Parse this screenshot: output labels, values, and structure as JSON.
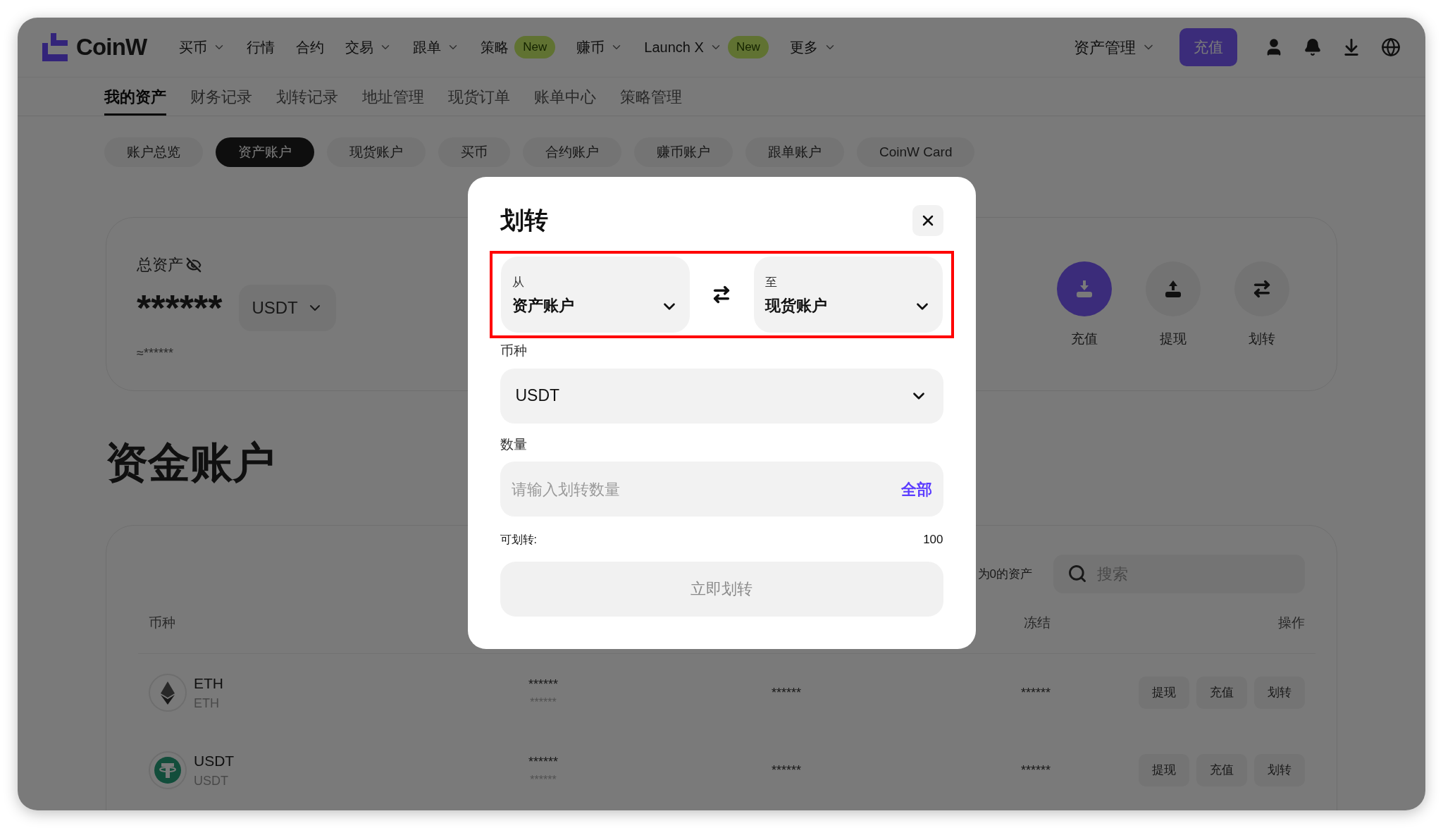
{
  "nav": {
    "logo": "CoinW",
    "items": [
      {
        "label": "买币",
        "dropdown": true
      },
      {
        "label": "行情",
        "dropdown": false
      },
      {
        "label": "合约",
        "dropdown": false
      },
      {
        "label": "交易",
        "dropdown": true
      },
      {
        "label": "跟单",
        "dropdown": true
      },
      {
        "label": "策略",
        "dropdown": false,
        "badge": "New"
      },
      {
        "label": "赚币",
        "dropdown": true
      },
      {
        "label": "Launch X",
        "dropdown": true,
        "badge": "New"
      },
      {
        "label": "更多",
        "dropdown": true
      }
    ],
    "asset_menu": "资产管理",
    "deposit_button": "充值"
  },
  "sub_tabs": [
    {
      "label": "我的资产",
      "selected": true
    },
    {
      "label": "财务记录",
      "selected": false
    },
    {
      "label": "划转记录",
      "selected": false
    },
    {
      "label": "地址管理",
      "selected": false
    },
    {
      "label": "现货订单",
      "selected": false
    },
    {
      "label": "账单中心",
      "selected": false
    },
    {
      "label": "策略管理",
      "selected": false
    }
  ],
  "account_tabs": [
    {
      "label": "账户总览",
      "selected": false
    },
    {
      "label": "资产账户",
      "selected": true
    },
    {
      "label": "现货账户",
      "selected": false
    },
    {
      "label": "买币",
      "selected": false
    },
    {
      "label": "合约账户",
      "selected": false
    },
    {
      "label": "赚币账户",
      "selected": false
    },
    {
      "label": "跟单账户",
      "selected": false
    },
    {
      "label": "CoinW Card",
      "selected": false
    }
  ],
  "summary": {
    "label": "总资产",
    "amount": "******",
    "currency": "USDT",
    "approx": "≈******",
    "actions": [
      {
        "label": "充值",
        "kind": "deposit",
        "primary": true
      },
      {
        "label": "提现",
        "kind": "withdraw",
        "primary": false
      },
      {
        "label": "划转",
        "kind": "transfer",
        "primary": false
      }
    ]
  },
  "section_title": "资金账户",
  "table": {
    "filter_text": "为0的资产",
    "search_placeholder": "搜索",
    "columns": [
      {
        "label": "币种"
      },
      {
        "label": "冻结"
      },
      {
        "label": "操作"
      }
    ],
    "rows": [
      {
        "symbol": "ETH",
        "name": "ETH",
        "kind": "eth",
        "column_2": "******",
        "column_2_sub": "******",
        "column_3": "******",
        "frozen": "******",
        "actions": [
          "提现",
          "充值",
          "划转"
        ]
      },
      {
        "symbol": "USDT",
        "name": "USDT",
        "kind": "usdt",
        "column_2": "******",
        "column_2_sub": "******",
        "column_3": "******",
        "frozen": "******",
        "actions": [
          "提现",
          "充值",
          "划转"
        ]
      }
    ]
  },
  "modal": {
    "title": "划转",
    "highlighted": true,
    "from": {
      "label": "从",
      "value": "资产账户"
    },
    "to": {
      "label": "至",
      "value": "现货账户"
    },
    "coin_label": "币种",
    "coin": "USDT",
    "amount_label": "数量",
    "amount_placeholder": "请输入划转数量",
    "max_button": "全部",
    "available_label": "可划转:",
    "available": "100",
    "submit": "立即划转",
    "submit_disabled": true
  }
}
